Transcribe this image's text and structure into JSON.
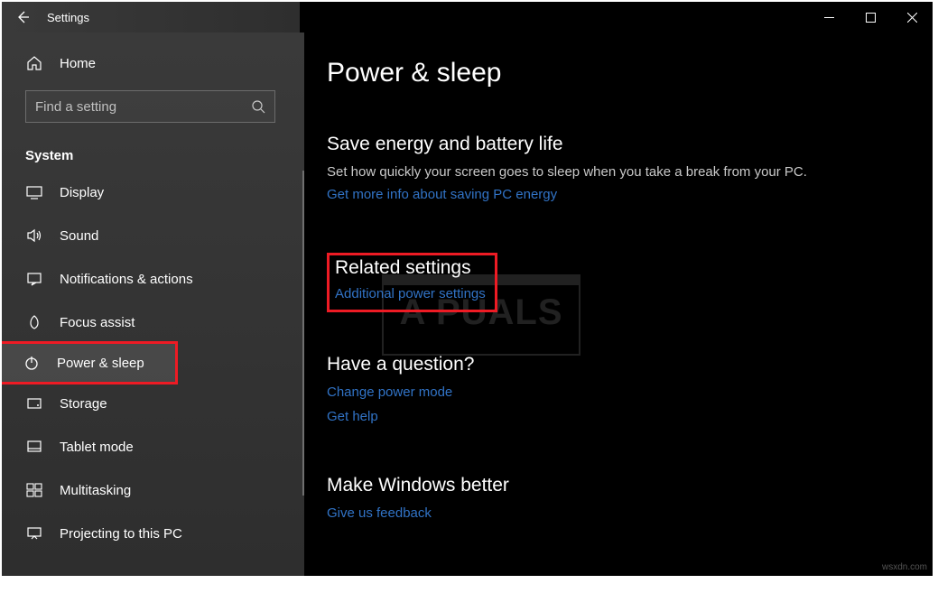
{
  "window": {
    "title": "Settings"
  },
  "sidebar": {
    "home_label": "Home",
    "search_placeholder": "Find a setting",
    "category": "System",
    "items": [
      {
        "label": "Display"
      },
      {
        "label": "Sound"
      },
      {
        "label": "Notifications & actions"
      },
      {
        "label": "Focus assist"
      },
      {
        "label": "Power & sleep"
      },
      {
        "label": "Storage"
      },
      {
        "label": "Tablet mode"
      },
      {
        "label": "Multitasking"
      },
      {
        "label": "Projecting to this PC"
      }
    ],
    "selected_index": 4
  },
  "main": {
    "page_title": "Power & sleep",
    "sections": {
      "save_energy": {
        "heading": "Save energy and battery life",
        "desc": "Set how quickly your screen goes to sleep when you take a break from your PC.",
        "link": "Get more info about saving PC energy"
      },
      "related": {
        "heading": "Related settings",
        "link": "Additional power settings"
      },
      "question": {
        "heading": "Have a question?",
        "links": [
          "Change power mode",
          "Get help"
        ]
      },
      "feedback": {
        "heading": "Make Windows better",
        "link": "Give us feedback"
      }
    }
  },
  "watermark": "A  PUALS",
  "footer_watermark": "wsxdn.com"
}
